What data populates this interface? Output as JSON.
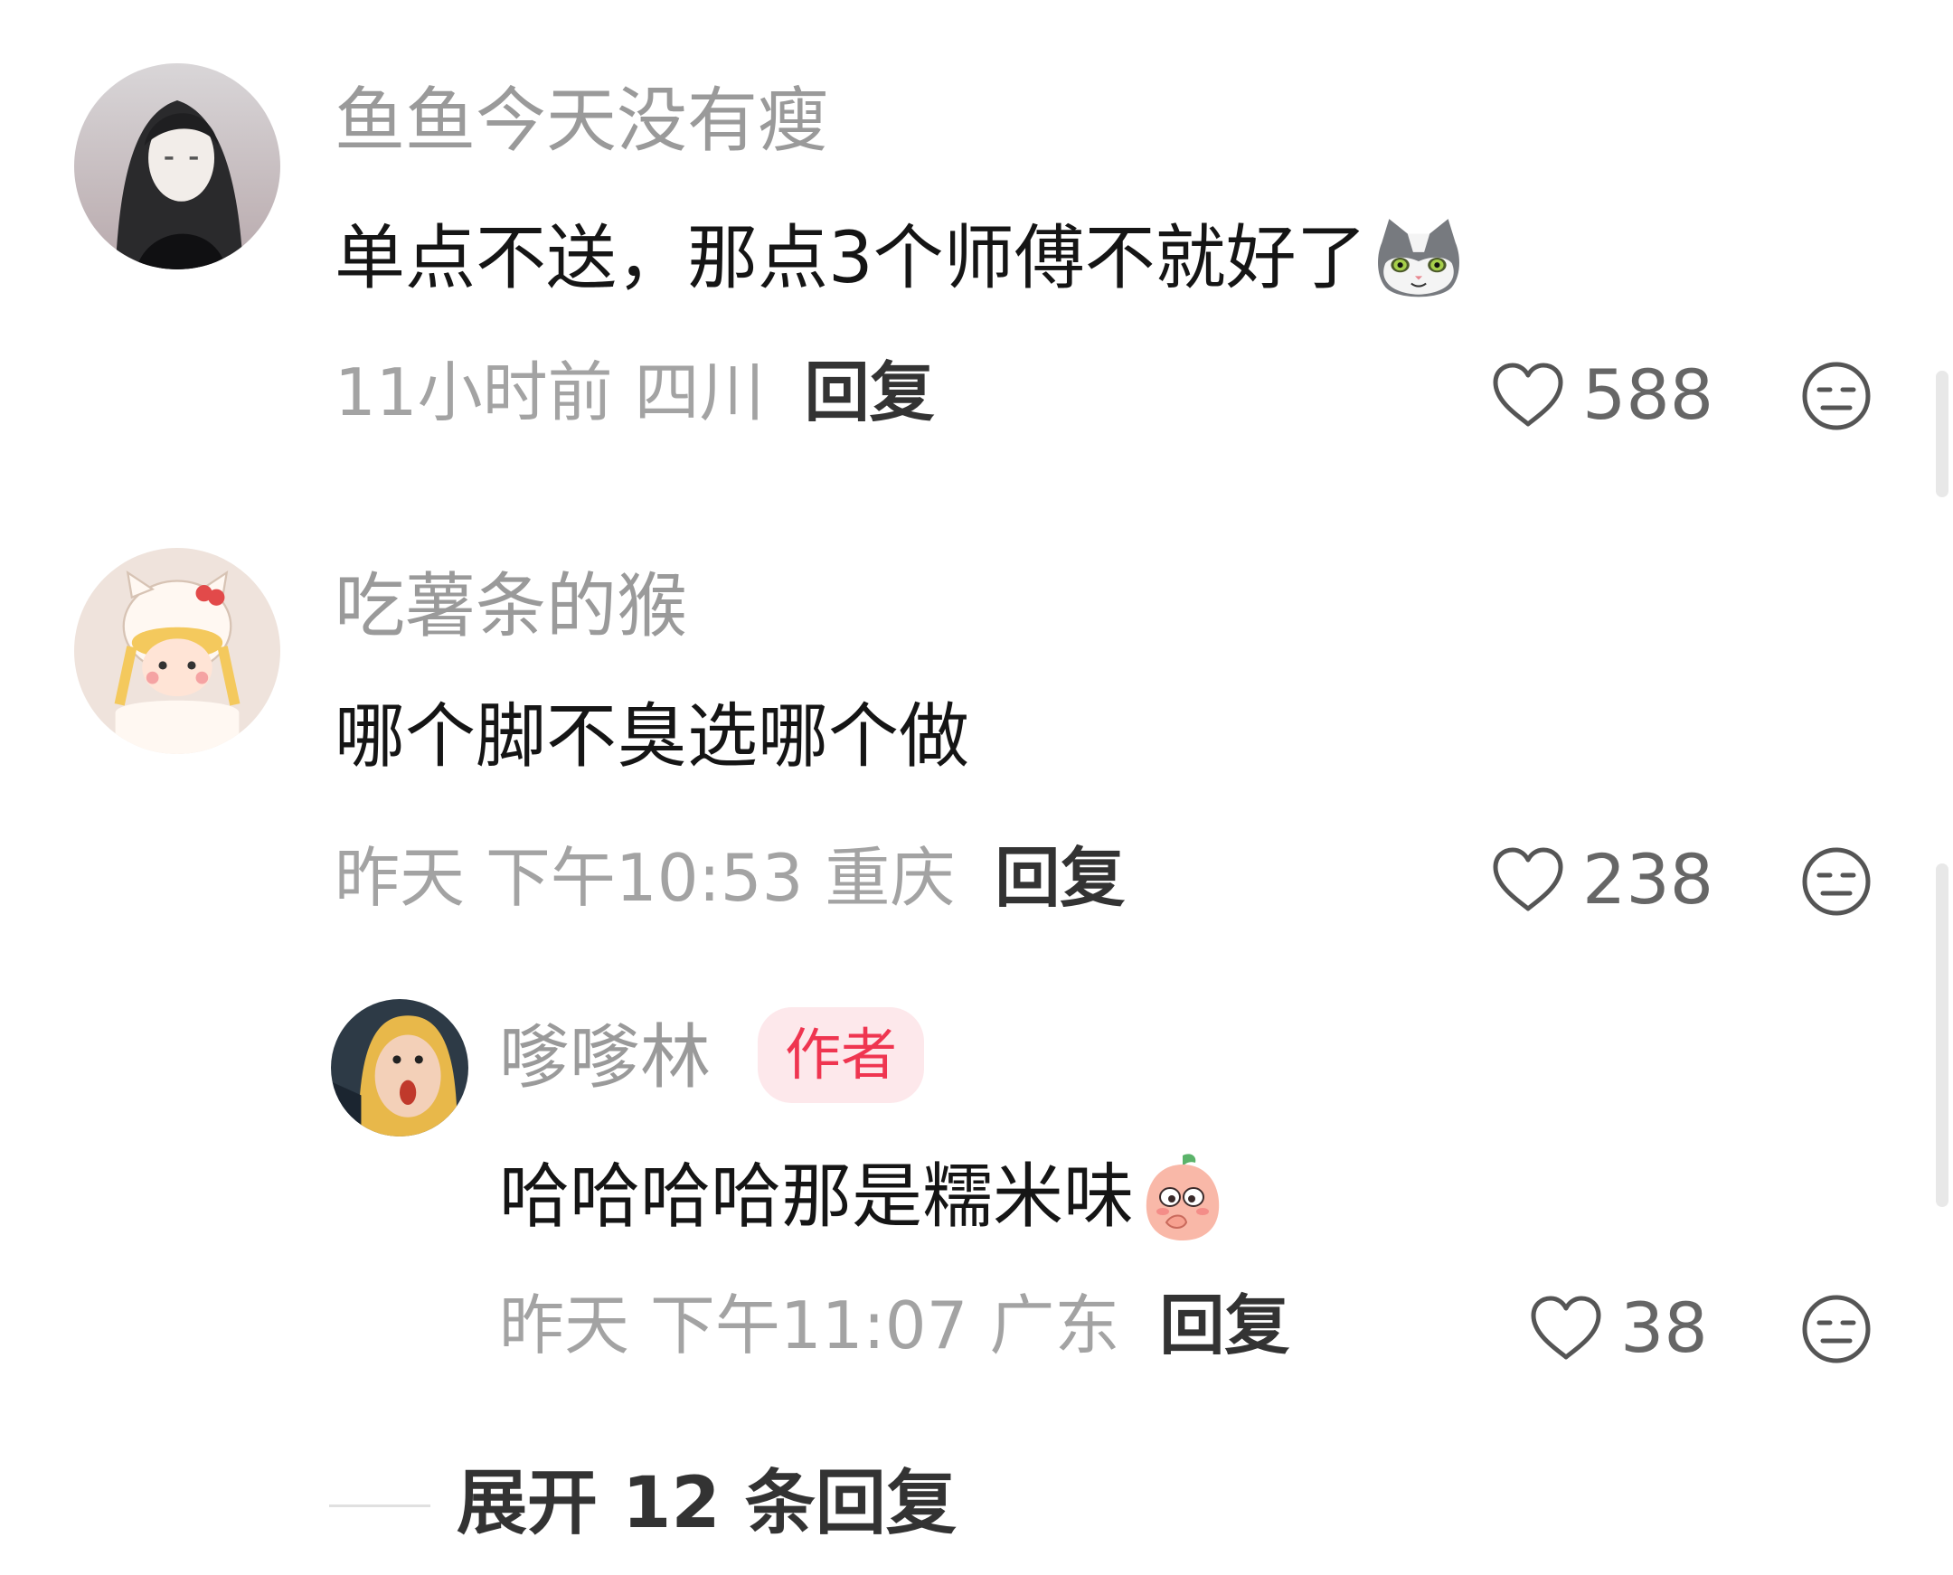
{
  "comments": [
    {
      "username": "鱼鱼今天没有瘦",
      "text": "单点不送，那点3个师傅不就好了",
      "emoji": "cat-face-emoji",
      "time": "11小时前",
      "location": "四川",
      "reply_label": "回复",
      "likes": "588"
    },
    {
      "username": "吃薯条的猴",
      "text": "哪个脚不臭选哪个做",
      "time": "昨天 下午10:53",
      "location": "重庆",
      "reply_label": "回复",
      "likes": "238"
    }
  ],
  "reply": {
    "username": "嗲嗲林",
    "badge": "作者",
    "text": "哈哈哈哈那是糯米味",
    "emoji": "peach-shy-emoji",
    "time": "昨天 下午11:07",
    "location": "广东",
    "reply_label": "回复",
    "likes": "38"
  },
  "expand_label": "展开 12 条回复",
  "colors": {
    "badge_bg": "#fde8eb",
    "badge_text": "#ef3550",
    "muted": "#a3a3a3"
  }
}
